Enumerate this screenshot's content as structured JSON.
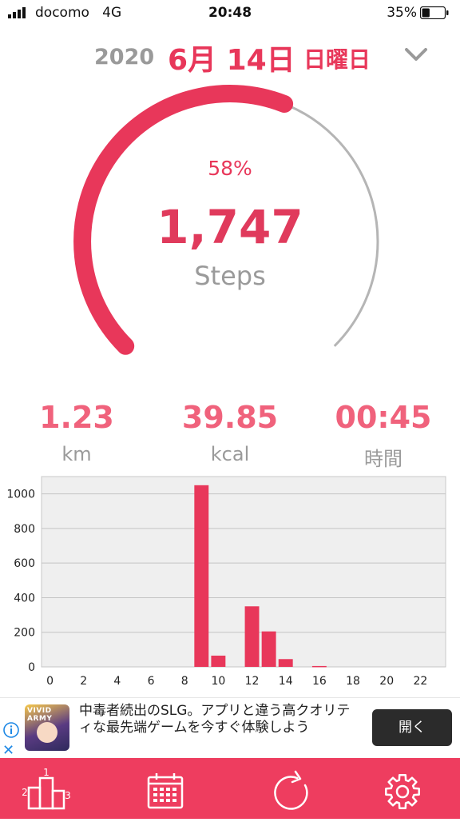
{
  "status_bar": {
    "carrier": "docomo",
    "network": "4G",
    "time": "20:48",
    "battery_pct": "35%",
    "battery_level": 0.35
  },
  "date": {
    "year": "2020",
    "day": "6月 14日",
    "weekday": "日曜日"
  },
  "progress": {
    "percent_label": "58%",
    "fraction": 0.58,
    "steps": "1,747",
    "steps_label": "Steps"
  },
  "stats": [
    {
      "value": "1.23",
      "unit": "km"
    },
    {
      "value": "39.85",
      "unit": "kcal"
    },
    {
      "value": "00:45",
      "unit": "時間"
    }
  ],
  "chart_data": {
    "type": "bar",
    "title": "",
    "xlabel": "",
    "ylabel": "",
    "x_ticks": [
      "0",
      "2",
      "4",
      "6",
      "8",
      "10",
      "12",
      "14",
      "16",
      "18",
      "20",
      "22"
    ],
    "y_ticks": [
      "0",
      "200",
      "400",
      "600",
      "800",
      "1000"
    ],
    "ylim": [
      0,
      1100
    ],
    "xlim": [
      -0.5,
      23.5
    ],
    "grid": true,
    "hours": [
      0,
      1,
      2,
      3,
      4,
      5,
      6,
      7,
      8,
      9,
      10,
      11,
      12,
      13,
      14,
      15,
      16,
      17,
      18,
      19,
      20,
      21,
      22,
      23
    ],
    "values": [
      0,
      0,
      0,
      0,
      0,
      0,
      0,
      0,
      0,
      1050,
      65,
      0,
      350,
      205,
      45,
      0,
      5,
      0,
      0,
      0,
      0,
      0,
      0,
      0
    ],
    "bar_color": "#e8375a",
    "background": "#efefef"
  },
  "ad": {
    "icon_text": "VIVID ARMY",
    "text": "中毒者続出のSLG。アプリと違う高クオリティな最先端ゲームを今すぐ体験しよう",
    "button": "開く"
  },
  "tabbar": {
    "items": [
      {
        "icon": "podium-icon",
        "digits": [
          "1",
          "2",
          "3"
        ]
      },
      {
        "icon": "calendar-icon"
      },
      {
        "icon": "refresh-icon"
      },
      {
        "icon": "gear-icon"
      }
    ]
  },
  "colors": {
    "accent": "#e8375a",
    "ring_track": "#b5b5b5",
    "stat_value": "#f0627c",
    "muted": "#9a9a9a",
    "tabbar": "#ee3d5f"
  }
}
